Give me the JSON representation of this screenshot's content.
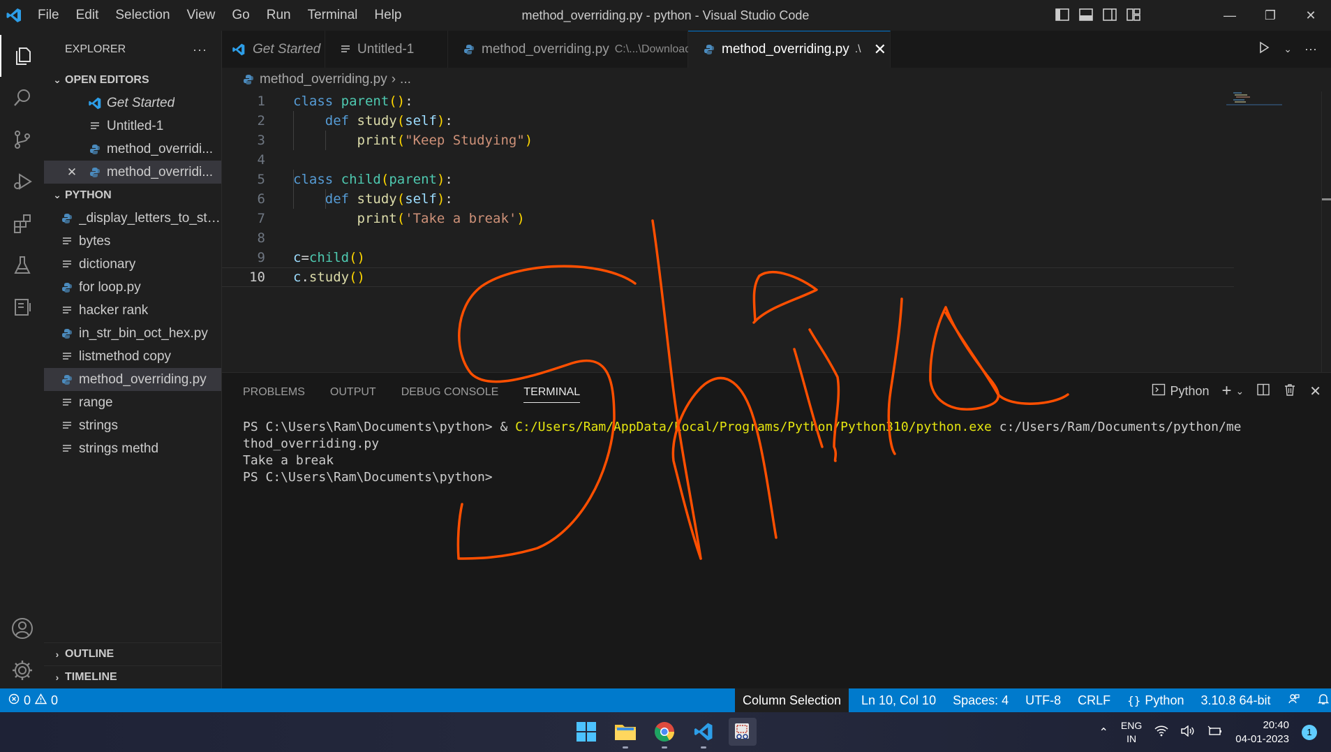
{
  "window": {
    "title": "method_overriding.py - python - Visual Studio Code",
    "menu": [
      "File",
      "Edit",
      "Selection",
      "View",
      "Go",
      "Run",
      "Terminal",
      "Help"
    ]
  },
  "sidebar": {
    "header": "EXPLORER",
    "more": "···",
    "open_editors_title": "OPEN EDITORS",
    "open_editors": [
      {
        "label": "Get Started",
        "icon": "vscode-icon"
      },
      {
        "label": "Untitled-1",
        "icon": "lines-icon"
      },
      {
        "label": "method_overridi...",
        "icon": "python-icon"
      },
      {
        "label": "method_overridi...",
        "icon": "python-icon",
        "close": "✕"
      }
    ],
    "folder_title": "PYTHON",
    "files": [
      {
        "label": "_display_letters_to_str...",
        "icon": "python-icon"
      },
      {
        "label": "bytes",
        "icon": "lines-icon"
      },
      {
        "label": "dictionary",
        "icon": "lines-icon"
      },
      {
        "label": "for loop.py",
        "icon": "python-icon"
      },
      {
        "label": "hacker rank",
        "icon": "lines-icon"
      },
      {
        "label": "in_str_bin_oct_hex.py",
        "icon": "python-icon"
      },
      {
        "label": "listmethod copy",
        "icon": "lines-icon"
      },
      {
        "label": "method_overriding.py",
        "icon": "python-icon"
      },
      {
        "label": "range",
        "icon": "lines-icon"
      },
      {
        "label": "strings",
        "icon": "lines-icon"
      },
      {
        "label": "strings methd",
        "icon": "lines-icon"
      }
    ],
    "outline_title": "OUTLINE",
    "timeline_title": "TIMELINE"
  },
  "tabs": [
    {
      "label": "Get Started",
      "desc": ""
    },
    {
      "label": "Untitled-1",
      "desc": ""
    },
    {
      "label": "method_overriding.py",
      "desc": "C:\\...\\Downloads"
    },
    {
      "label": "method_overriding.py",
      "desc": ".\\",
      "close": "✕"
    }
  ],
  "breadcrumb": {
    "file": "method_overriding.py",
    "sep": "›",
    "more": "..."
  },
  "editor": {
    "line_numbers": [
      "1",
      "2",
      "3",
      "4",
      "5",
      "6",
      "7",
      "8",
      "9",
      "10"
    ],
    "lines": {
      "l1_kw": "class",
      "l1_name": "parent",
      "l1_paren": "()",
      "l1_colon": ":",
      "l2_kw": "def",
      "l2_name": "study",
      "l2_open": "(",
      "l2_arg": "self",
      "l2_close": ")",
      "l2_colon": ":",
      "l3_fn": "print",
      "l3_open": "(",
      "l3_str": "\"Keep Studying\"",
      "l3_close": ")",
      "l5_kw": "class",
      "l5_name": "child",
      "l5_open": "(",
      "l5_arg": "parent",
      "l5_close": ")",
      "l5_colon": ":",
      "l6_kw": "def",
      "l6_name": "study",
      "l6_open": "(",
      "l6_arg": "self",
      "l6_close": ")",
      "l6_colon": ":",
      "l7_fn": "print",
      "l7_open": "(",
      "l7_str": "'Take a break'",
      "l7_close": ")",
      "l9_var": "c",
      "l9_eq": "=",
      "l9_cls": "child",
      "l9_paren": "()",
      "l10_var": "c",
      "l10_dot": ".",
      "l10_fn": "study",
      "l10_paren": "()"
    }
  },
  "panel": {
    "tabs": [
      "PROBLEMS",
      "OUTPUT",
      "DEBUG CONSOLE",
      "TERMINAL"
    ],
    "terminal_profile": "Python",
    "terminal": {
      "line1_prompt": "PS C:\\Users\\Ram\\Documents\\python> ",
      "line1_amp": "& ",
      "line1_exe": "C:/Users/Ram/AppData/Local/Programs/Python/Python310/python.exe",
      "line1_arg": " c:/Users/Ram/Documents/python/me",
      "line2": "thod_overriding.py",
      "line3": "Take a break",
      "line4": "PS C:\\Users\\Ram\\Documents\\python>"
    }
  },
  "statusbar": {
    "errors": "0",
    "warnings": "0",
    "selection_mode": "Column Selection",
    "position": "Ln 10, Col 10",
    "spaces": "Spaces: 4",
    "encoding": "UTF-8",
    "eol": "CRLF",
    "language": "Python",
    "interpreter": "3.10.8 64-bit"
  },
  "taskbar": {
    "lang_top": "ENG",
    "lang_bottom": "IN",
    "time": "20:40",
    "date": "04-01-2023",
    "notifications": "1"
  },
  "colors": {
    "accent": "#007acc",
    "ink": "#ff4f00",
    "keyword": "#569cd6",
    "class": "#4ec9b0",
    "function": "#dcdcaa",
    "string": "#ce9178"
  }
}
